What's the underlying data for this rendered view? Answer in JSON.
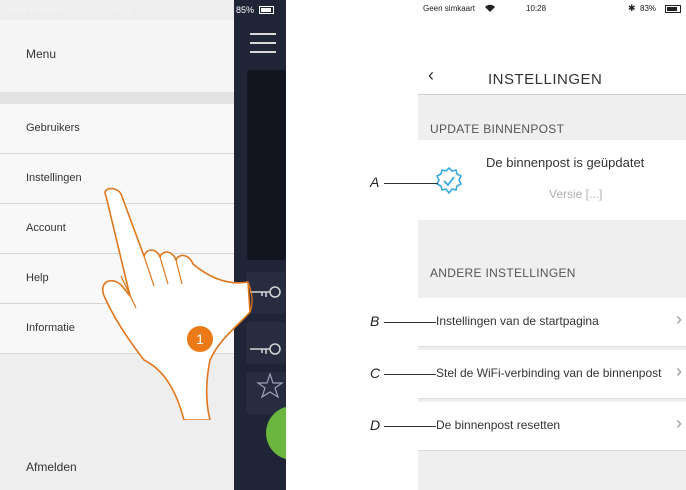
{
  "left_phone": {
    "status": {
      "carrier": "Geen simkaart",
      "time": "10:25",
      "battery": "85%"
    },
    "menu": {
      "title": "Menu",
      "items": [
        {
          "label": "Gebruikers"
        },
        {
          "label": "Instellingen"
        },
        {
          "label": "Account"
        },
        {
          "label": "Help"
        },
        {
          "label": "Informatie"
        }
      ],
      "logout": "Afmelden"
    },
    "step_badge": "1"
  },
  "right_phone": {
    "status": {
      "carrier": "Geen simkaart",
      "time": "10:28",
      "battery": "83%"
    },
    "nav": {
      "back_label": "‹",
      "title": "INSTELLINGEN"
    },
    "update_section": {
      "header": "UPDATE BINNENPOST",
      "message": "De binnenpost is geüpdatet",
      "version": "Versie [...]"
    },
    "other_section": {
      "header": "ANDERE INSTELLINGEN",
      "items": [
        {
          "label": "Instellingen van de startpagina"
        },
        {
          "label": "Stel de WiFi-verbinding van de binnenpost"
        },
        {
          "label": "De binnenpost resetten"
        }
      ]
    }
  },
  "callouts": [
    "A",
    "B",
    "C",
    "D"
  ],
  "colors": {
    "accent_orange": "#ea7a18",
    "gear_blue": "#3aa9e0",
    "call_green": "#6bb63f",
    "dark_bg": "#1f2436"
  }
}
